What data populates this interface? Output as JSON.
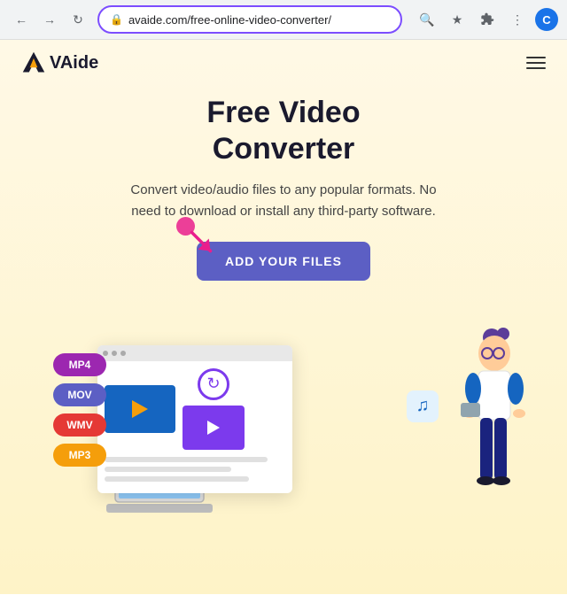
{
  "browser": {
    "url": "avaide.com/free-online-video-converter/",
    "back_disabled": false,
    "forward_disabled": false
  },
  "nav": {
    "logo_text": "VAide",
    "logo_v": "V",
    "logo_a": "A"
  },
  "hero": {
    "title_line1": "Free Video",
    "title_line2": "Converter",
    "subtitle": "Convert video/audio files to any popular formats. No need to download or install any third-party software.",
    "cta_button": "ADD YOUR FILES"
  },
  "formats": [
    {
      "label": "MP4",
      "class": "badge-mp4"
    },
    {
      "label": "MOV",
      "class": "badge-mov"
    },
    {
      "label": "WMV",
      "class": "badge-wmv"
    },
    {
      "label": "MP3",
      "class": "badge-mp3"
    }
  ],
  "toolbar": {
    "search_title": "Search",
    "star_title": "Bookmark",
    "extensions_title": "Extensions",
    "menu_title": "More",
    "profile_letter": "C"
  }
}
